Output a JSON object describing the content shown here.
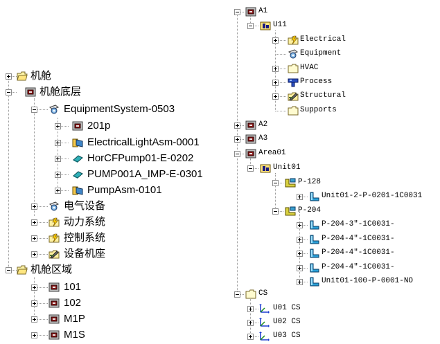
{
  "left_tree": {
    "nodes": [
      {
        "label": "机舱",
        "icon": "folder-open-icon"
      },
      {
        "label": "机舱底层",
        "icon": "area-box-icon"
      },
      {
        "label": "EquipmentSystem-0503",
        "icon": "equipment-icon"
      },
      {
        "label": "201p",
        "icon": "area-box-icon"
      },
      {
        "label": "ElectricalLightAsm-0001",
        "icon": "assembly-icon"
      },
      {
        "label": "HorCFPump01-E-0202",
        "icon": "pump-icon"
      },
      {
        "label": "PUMP001A_IMP-E-0301",
        "icon": "pump-icon"
      },
      {
        "label": "PumpAsm-0101",
        "icon": "assembly-icon"
      },
      {
        "label": "电气设备",
        "icon": "equipment-icon"
      },
      {
        "label": "动力系统",
        "icon": "electrical-folder-icon"
      },
      {
        "label": "控制系统",
        "icon": "electrical-folder-icon"
      },
      {
        "label": "设备机座",
        "icon": "structural-icon"
      },
      {
        "label": "机舱区域",
        "icon": "folder-open-icon"
      },
      {
        "label": "101",
        "icon": "area-box-icon"
      },
      {
        "label": "102",
        "icon": "area-box-icon"
      },
      {
        "label": "M1P",
        "icon": "area-box-icon"
      },
      {
        "label": "M1S",
        "icon": "area-box-icon"
      }
    ]
  },
  "right_tree": {
    "nodes": [
      {
        "label": "A1",
        "icon": "area-box-icon"
      },
      {
        "label": "U11",
        "icon": "unit-icon"
      },
      {
        "label": "Electrical",
        "icon": "electrical-folder-icon"
      },
      {
        "label": "Equipment",
        "icon": "equipment-icon"
      },
      {
        "label": "HVAC",
        "icon": "folder-icon"
      },
      {
        "label": "Process",
        "icon": "process-icon"
      },
      {
        "label": "Structural",
        "icon": "structural-icon"
      },
      {
        "label": "Supports",
        "icon": "folder-icon"
      },
      {
        "label": "A2",
        "icon": "area-box-icon"
      },
      {
        "label": "A3",
        "icon": "area-box-icon"
      },
      {
        "label": "Area01",
        "icon": "area-box-icon"
      },
      {
        "label": "Unit01",
        "icon": "unit-icon"
      },
      {
        "label": "P-128",
        "icon": "pipeline-icon"
      },
      {
        "label": "Unit01-2-P-0201-1C0031",
        "icon": "pipe-run-icon"
      },
      {
        "label": "P-204",
        "icon": "pipeline-icon"
      },
      {
        "label": "P-204-3\"-1C0031-",
        "icon": "pipe-run-icon"
      },
      {
        "label": "P-204-4\"-1C0031-",
        "icon": "pipe-run-icon"
      },
      {
        "label": "P-204-4\"-1C0031-",
        "icon": "pipe-run-icon"
      },
      {
        "label": "P-204-4\"-1C0031-",
        "icon": "pipe-run-icon"
      },
      {
        "label": "Unit01-100-P-0001-NO",
        "icon": "pipe-run-icon"
      },
      {
        "label": "CS",
        "icon": "folder-icon"
      },
      {
        "label": "U01 CS",
        "icon": "coordinate-system-icon"
      },
      {
        "label": "U02 CS",
        "icon": "coordinate-system-icon"
      },
      {
        "label": "U03 CS",
        "icon": "coordinate-system-icon"
      }
    ]
  }
}
